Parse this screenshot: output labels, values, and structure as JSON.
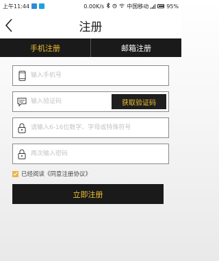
{
  "status": {
    "time": "上午11:44",
    "speed": "0.00K/s",
    "carrier": "中国移动",
    "battery": "95%"
  },
  "nav": {
    "title": "注册",
    "back_icon": "chevron-left-icon"
  },
  "tabs": [
    {
      "label": "手机注册",
      "active": true
    },
    {
      "label": "邮箱注册",
      "active": false
    }
  ],
  "form": {
    "phone_placeholder": "输入手机号",
    "code_placeholder": "输入验证码",
    "code_button": "获取验证码",
    "password_placeholder": "请输入6-16位数字、字母或特殊符号",
    "confirm_placeholder": "再次输入密码",
    "agree_text": "已经阅读《同意注册协议》",
    "agree_checked": true,
    "submit_label": "立即注册"
  },
  "colors": {
    "accent": "#f2c134",
    "dark": "#1a1a1a",
    "checkbox": "#e9b54a"
  }
}
